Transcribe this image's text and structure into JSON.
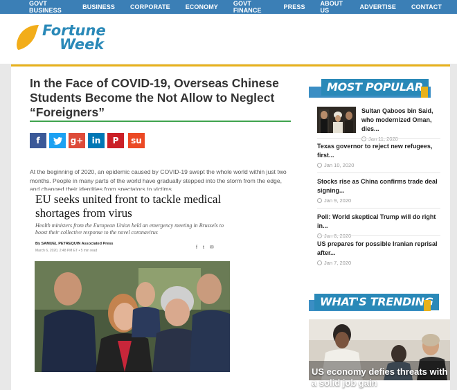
{
  "nav": {
    "items": [
      "GOVT BUSINESS",
      "BUSINESS",
      "CORPORATE",
      "ECONOMY",
      "GOVT FINANCE",
      "PRESS",
      "ABOUT US",
      "ADVERTISE",
      "CONTACT"
    ]
  },
  "logo": {
    "line1": "Fortune",
    "line2": "Week"
  },
  "article": {
    "title": "In the Face of COVID-19, Overseas Chinese Students Become the Not Allow to Neglect “Foreigners”",
    "body": "At the beginning of 2020, an epidemic caused by COVID-19 swept the whole world within just two months. People in many parts of the world have gradually stepped into the storm from the edge, and changed their identities from spectators to victims."
  },
  "share": [
    {
      "icon": "facebook-icon",
      "glyph": "f",
      "color": "#3b5998"
    },
    {
      "icon": "twitter-icon",
      "glyph": "t",
      "color": "#1da1f2"
    },
    {
      "icon": "google-plus-icon",
      "glyph": "g+",
      "color": "#dd4b39"
    },
    {
      "icon": "linkedin-icon",
      "glyph": "in",
      "color": "#0077b5"
    },
    {
      "icon": "pinterest-icon",
      "glyph": "P",
      "color": "#cb2027"
    },
    {
      "icon": "stumbleupon-icon",
      "glyph": "su",
      "color": "#eb4924"
    }
  ],
  "embed": {
    "headline": "EU seeks united front to tackle medical shortages from virus",
    "subhead": "Health ministers from the European Union held an emergency meeting in Brussels to boost their collective response to the novel coronavirus",
    "byline": "By SAMUEL PETREQUIN Associated Press",
    "date": "March 6, 2020, 2:48 PM ET • 5 min read"
  },
  "sidebar": {
    "most_popular_label": "MOST POPULAR",
    "trending_label": "WHAT'S TRENDING",
    "popular": [
      {
        "title": "Sultan Qaboos bin Said, who modernized Oman, dies...",
        "date": "Jan 11, 2020"
      },
      {
        "title": "Texas governor to reject new refugees, first...",
        "date": "Jan 10, 2020"
      },
      {
        "title": "Stocks rise as China confirms trade deal signing...",
        "date": "Jan 9, 2020"
      },
      {
        "title": "Poll: World skeptical Trump will do right in...",
        "date": "Jan 8, 2020"
      },
      {
        "title": "US prepares for possible Iranian reprisal after...",
        "date": "Jan 7, 2020"
      }
    ],
    "trending_caption": "US economy defies threats with a solid job gain"
  },
  "colors": {
    "nav_bg": "#3b7fb6",
    "brand_blue": "#2a89b8",
    "accent_yellow": "#e8b11a",
    "rule_green": "#3fa34d"
  }
}
